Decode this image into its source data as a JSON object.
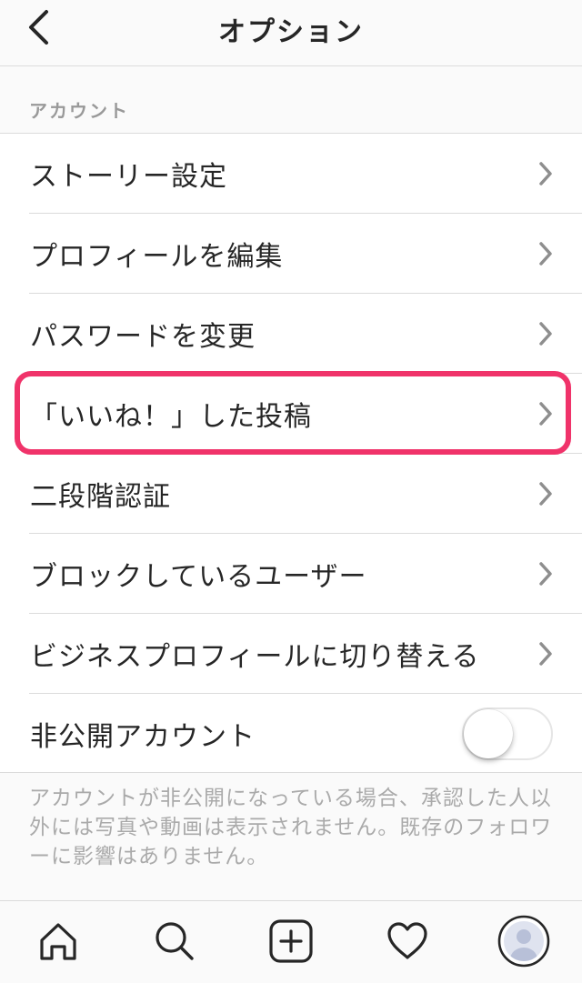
{
  "header": {
    "title": "オプション",
    "back_icon": "chevron-left-icon"
  },
  "section": {
    "label": "アカウント"
  },
  "items": [
    {
      "label": "ストーリー設定",
      "icon": "chevron-right-icon"
    },
    {
      "label": "プロフィールを編集",
      "icon": "chevron-right-icon"
    },
    {
      "label": "パスワードを変更",
      "icon": "chevron-right-icon"
    },
    {
      "label": "「いいね！」した投稿",
      "icon": "chevron-right-icon"
    },
    {
      "label": "二段階認証",
      "icon": "chevron-right-icon"
    },
    {
      "label": "ブロックしているユーザー",
      "icon": "chevron-right-icon"
    },
    {
      "label": "ビジネスプロフィールに切り替える",
      "icon": "chevron-right-icon"
    }
  ],
  "private_account": {
    "label": "非公開アカウント",
    "enabled": false
  },
  "footnote": "アカウントが非公開になっている場合、承認した人以外には写真や動画は表示されません。既存のフォロワーに影響はありません。",
  "tabbar": {
    "tabs": [
      "home-icon",
      "search-icon",
      "add-post-icon",
      "activity-heart-icon",
      "profile-avatar-icon"
    ]
  },
  "colors": {
    "highlight": "#f0336a",
    "text": "#262626",
    "muted": "#999999",
    "divider": "#dbdbdb"
  }
}
